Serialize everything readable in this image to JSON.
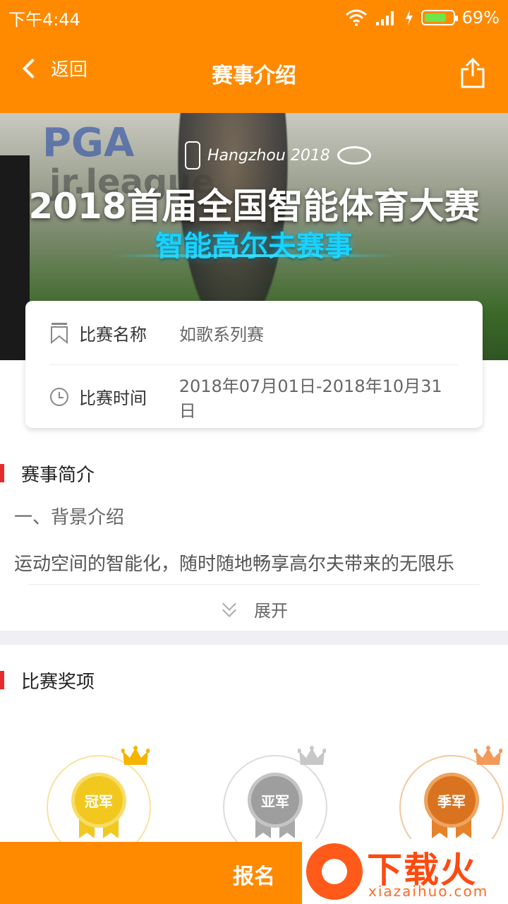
{
  "status_bar": {
    "time": "下午4:44",
    "battery": "69%",
    "battery_color": "#6fe44b"
  },
  "nav": {
    "back_label": "返回",
    "title": "赛事介绍",
    "share_icon": "share-icon"
  },
  "banner": {
    "city_text": "Hangzhou 2018",
    "sign_text": "PGA",
    "sign_text2": "jr.league",
    "headline": "2018首届全国智能体育大赛",
    "subline": "智能高尔夫赛事"
  },
  "info": {
    "name_label": "比赛名称",
    "name_value": "如歌系列赛",
    "time_label": "比赛时间",
    "time_value": "2018年07月01日-2018年10月31日"
  },
  "intro": {
    "heading": "赛事简介",
    "subheading": "一、背景介绍",
    "text": "运动空间的智能化，随时随地畅享高尔夫带来的无限乐",
    "expand_label": "展开"
  },
  "awards": {
    "heading": "比赛奖项",
    "items": [
      {
        "label": "冠军",
        "color": "#f2c81e"
      },
      {
        "label": "亚军",
        "color": "#a9a9a9"
      },
      {
        "label": "季军",
        "color": "#e6822a"
      }
    ]
  },
  "bottom": {
    "signup_label": "报名"
  },
  "watermark": {
    "title": "下载火",
    "url": "xiazaihuo.com"
  },
  "colors": {
    "accent": "#ff8a00",
    "section_bar": "#e52b2b"
  }
}
